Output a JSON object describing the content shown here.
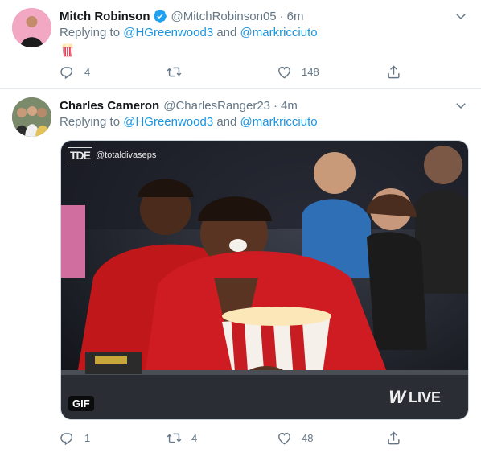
{
  "tweets": [
    {
      "name": "Mitch Robinson",
      "verified": true,
      "handle": "@MitchRobinson05",
      "time": "6m",
      "reply_prefix": "Replying to",
      "mention1": "@HGreenwood3",
      "reply_and": "and",
      "mention2": "@markricciuto",
      "body_emoji": "popcorn-icon",
      "replies": "4",
      "retweets": "",
      "likes": "148"
    },
    {
      "name": "Charles Cameron",
      "verified": false,
      "handle": "@CharlesRanger23",
      "time": "4m",
      "reply_prefix": "Replying to",
      "mention1": "@HGreenwood3",
      "reply_and": "and",
      "mention2": "@markricciuto",
      "media": {
        "badge": "GIF",
        "watermark_logo": "TDE",
        "watermark_text": "@totaldivaseps",
        "live_text": "LIVE"
      },
      "replies": "1",
      "retweets": "4",
      "likes": "48"
    }
  ],
  "colors": {
    "link": "#1b95e0",
    "muted": "#657786",
    "verified": "#1da1f2",
    "divider": "#e6ecf0"
  }
}
